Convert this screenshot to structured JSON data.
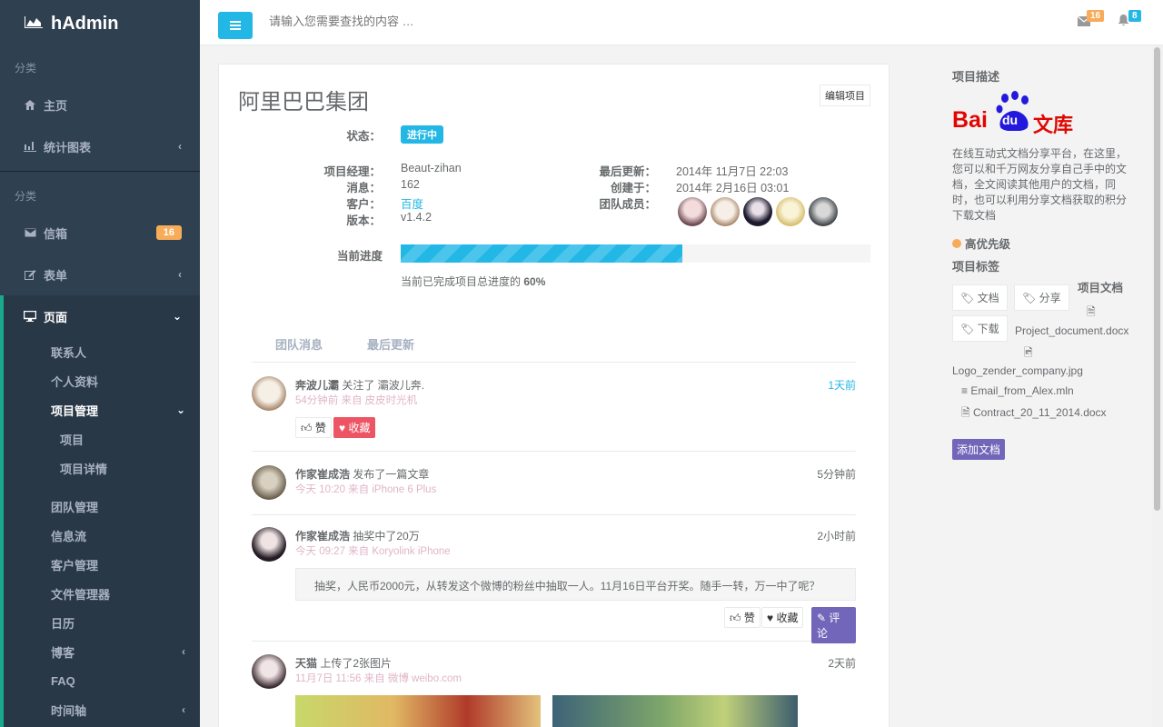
{
  "app": {
    "brand": "hAdmin"
  },
  "sidebar": {
    "section1": "分类",
    "home": "主页",
    "stats": "统计图表",
    "section2": "分类",
    "mailbox": "信箱",
    "mailbox_badge": "16",
    "forms": "表单",
    "pages": "页面",
    "sub": {
      "contacts": "联系人",
      "profile": "个人资料",
      "projects": "项目管理",
      "project": "项目",
      "project_detail": "项目详情",
      "teams": "团队管理",
      "feed": "信息流",
      "clients": "客户管理",
      "files": "文件管理器",
      "calendar": "日历",
      "blog": "博客",
      "faq": "FAQ",
      "timeline": "时间轴"
    }
  },
  "topbar": {
    "search_placeholder": "请输入您需要查找的内容 …",
    "mail_count": "16",
    "bell_count": "8"
  },
  "project": {
    "title": "阿里巴巴集团",
    "edit_label": "编辑项目",
    "status_label": "状态：",
    "status_value": "进行中",
    "manager_label": "项目经理：",
    "manager_value": "Beaut-zihan",
    "messages_label": "消息：",
    "messages_value": "162",
    "client_label": "客户：",
    "client_value": "百度",
    "version_label": "版本：",
    "version_value": "v1.4.2",
    "updated_label": "最后更新：",
    "updated_value": "2014年 11月7日 22:03",
    "created_label": "创建于：",
    "created_value": "2014年 2月16日 03:01",
    "team_label": "团队成员：",
    "progress_label": "当前进度",
    "progress_percent": 60,
    "progress_text_prefix": "当前已完成项目总进度的",
    "progress_text_value": "60%"
  },
  "tabs": [
    "团队消息",
    "最后更新"
  ],
  "feed": [
    {
      "name": "奔波儿灞",
      "action": "关注了 灞波儿奔.",
      "meta": "54分钟前 来自 皮皮时光机",
      "time": "1天前",
      "like": "赞",
      "fav": "收藏"
    },
    {
      "name": "作家崔成浩",
      "action": "发布了一篇文章",
      "meta": "今天 10:20 来自 iPhone 6 Plus",
      "time": "5分钟前"
    },
    {
      "name": "作家崔成浩",
      "action": "抽奖中了20万",
      "meta": "今天 09:27 来自 Koryolink iPhone",
      "time": "2小时前",
      "quote": "抽奖，人民币2000元，从转发这个微博的粉丝中抽取一人。11月16日平台开奖。随手一转，万一中了呢？",
      "like": "赞",
      "fav": "收藏",
      "comment": "评论"
    },
    {
      "name": "天猫",
      "action": "上传了2张图片",
      "meta": "11月7日 11:56 来自 微博 weibo.com",
      "time": "2天前"
    }
  ],
  "right": {
    "desc_title": "项目描述",
    "logo_bai": "Bai",
    "logo_du": "du",
    "logo_wenku": "文库",
    "desc": "在线互动式文档分享平台，在这里，您可以和千万网友分享自己手中的文档，全文阅读其他用户的文档，同时，也可以利用分享文档获取的积分下载文档",
    "priority": "高优先级",
    "tags_title": "项目标签",
    "tags": [
      "文档",
      "分享",
      "下载"
    ],
    "docs_title": "项目文档",
    "files": [
      "Project_document.docx",
      "Logo_zender_company.jpg",
      "Email_from_Alex.mln",
      "Contract_20_11_2014.docx"
    ],
    "add_doc": "添加文档"
  },
  "colors": {
    "accent": "#23b7e5",
    "sidebar": "#2f4050",
    "warning": "#f8ac59",
    "danger": "#ed5565",
    "purple": "#7266ba"
  }
}
